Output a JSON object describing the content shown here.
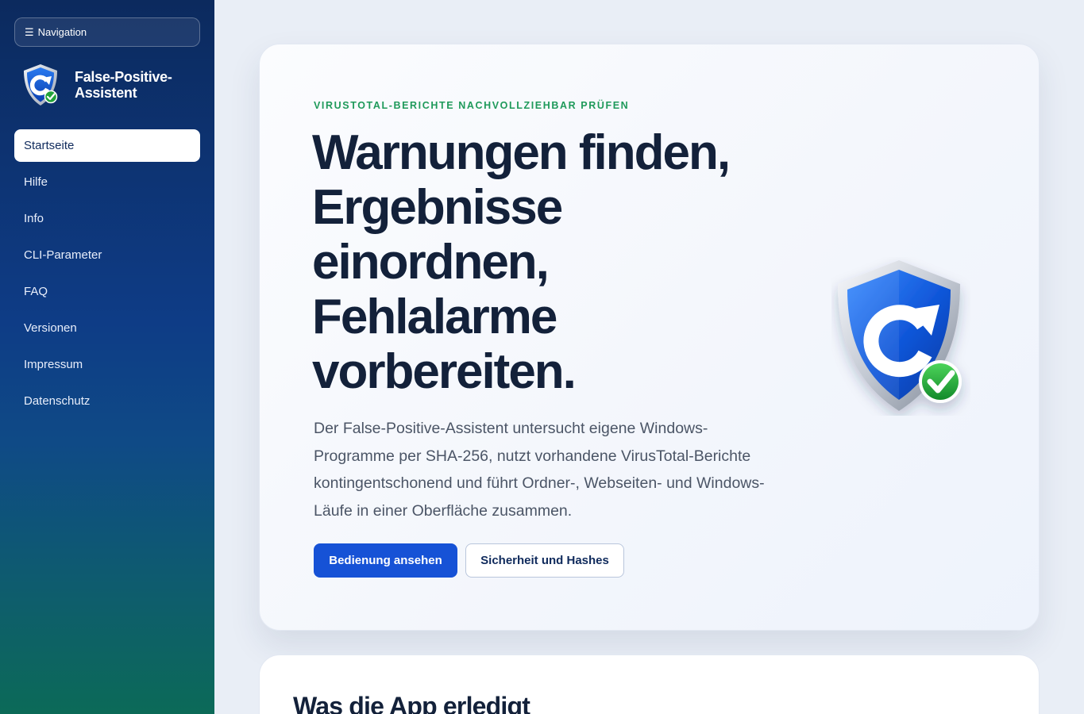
{
  "sidebar": {
    "toggle": {
      "icon": "menu-icon",
      "glyph": "☰",
      "label": "Navigation"
    },
    "brand": {
      "logo": "shield-refresh-check-icon",
      "name": "False-Positive-Assistent"
    },
    "items": [
      {
        "label": "Startseite",
        "active": true
      },
      {
        "label": "Hilfe"
      },
      {
        "label": "Info"
      },
      {
        "label": "CLI-Parameter"
      },
      {
        "label": "FAQ"
      },
      {
        "label": "Versionen"
      },
      {
        "label": "Impressum"
      },
      {
        "label": "Datenschutz"
      }
    ]
  },
  "hero": {
    "eyebrow": "VIRUSTOTAL-BERICHTE NACHVOLLZIEHBAR PRÜFEN",
    "title": "Warnungen finden, Ergebnisse einordnen, Fehlalarme vorbereiten.",
    "description": "Der False-Positive-Assistent untersucht eigene Windows-Programme per SHA-256, nutzt vorhandene VirusTotal-Berichte kontingentschonend und führt Ordner-, Webseiten- und Windows-Läufe in einer Oberfläche zusammen.",
    "primary_button": "Bedienung ansehen",
    "secondary_button": "Sicherheit und Hashes",
    "illustration": "shield-refresh-check-icon"
  },
  "section": {
    "title": "Was die App erledigt"
  },
  "colors": {
    "accent": "#1652d6",
    "eyebrow": "#1f9a5a",
    "title": "#13213a",
    "sidebar_top": "#0c2a5e",
    "sidebar_bottom": "#0c6a58"
  }
}
